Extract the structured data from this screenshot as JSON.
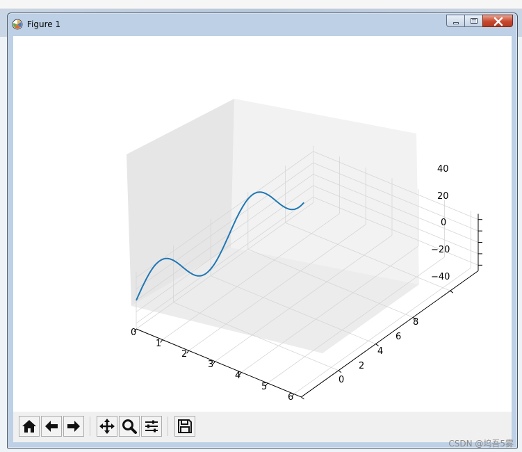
{
  "window": {
    "title": "Figure 1"
  },
  "toolbar": {
    "buttons": [
      "home-icon",
      "back-arrow-icon",
      "forward-arrow-icon",
      "pan-icon",
      "zoom-icon",
      "configure-subplots-icon",
      "save-icon"
    ]
  },
  "watermark": "CSDN @坞吾5雾",
  "colors": {
    "line": "#1f77b4",
    "pane": "#f2f2f2",
    "pane_side": "#e6e6e6",
    "grid": "#d6d6d6"
  },
  "chart_data": {
    "type": "line",
    "projection": "3d",
    "series": [
      {
        "function": "z = 40*sin(pi*y/2.5)",
        "y_range": [
          0,
          9
        ],
        "x": 0,
        "color": "#1f77b4"
      }
    ],
    "x_ticks": [
      "0",
      "1",
      "2",
      "3",
      "4",
      "5",
      "6"
    ],
    "y_ticks": [
      "0",
      "2",
      "4",
      "6",
      "8"
    ],
    "z_ticks": [
      "40",
      "20",
      "0",
      "−20",
      "−40"
    ],
    "xlim": [
      0,
      6.28
    ],
    "ylim": [
      0,
      9.5
    ],
    "zlim": [
      -50,
      50
    ],
    "grid": true
  }
}
